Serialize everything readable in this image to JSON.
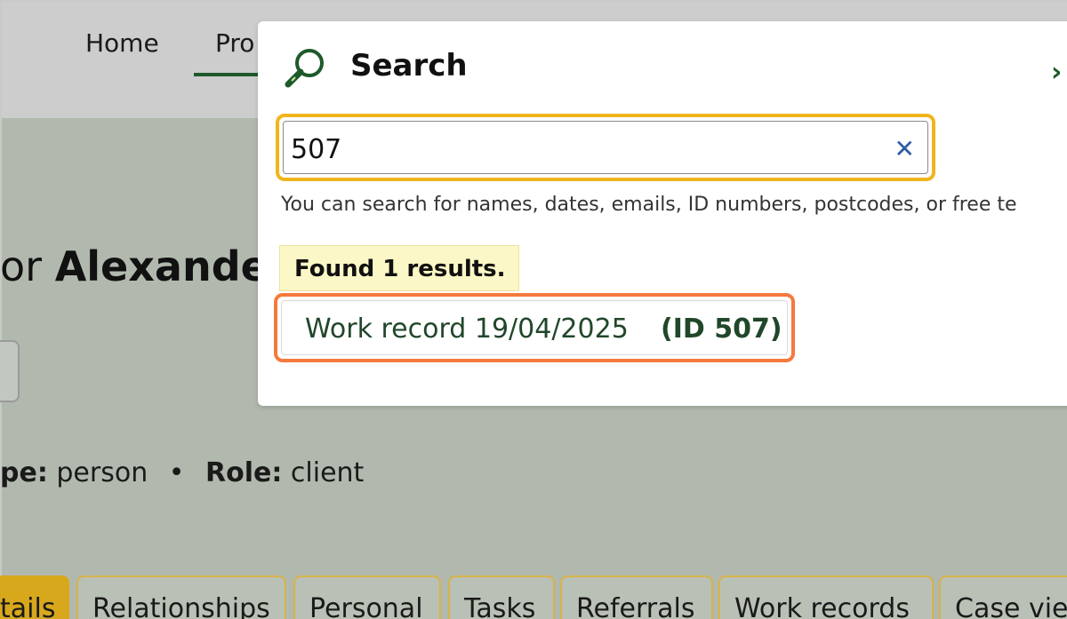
{
  "nav": {
    "home": "Home",
    "profile_partial": "Pro"
  },
  "page": {
    "title_prefix": "or ",
    "title_name": "Alexander",
    "meta_type_label": "pe:",
    "meta_type_value": "person",
    "meta_sep": "•",
    "meta_role_label": "Role:",
    "meta_role_value": "client"
  },
  "tabs": [
    {
      "label": "tails"
    },
    {
      "label": "Relationships"
    },
    {
      "label": "Personal"
    },
    {
      "label": "Tasks"
    },
    {
      "label": "Referrals"
    },
    {
      "label": "Work records"
    },
    {
      "label": "Case vie"
    }
  ],
  "search": {
    "title": "Search",
    "close_glyph": "›",
    "query": "507",
    "clear_glyph": "✕",
    "hint": "You can search for names, dates, emails, ID numbers, postcodes, or free te",
    "found_text": "Found 1 results.",
    "results": [
      {
        "label": "Work record 19/04/2025",
        "id_text": "(ID 507)"
      }
    ]
  },
  "icons": {
    "search": "magnifier-icon"
  },
  "colors": {
    "accent": "#1d5a2a",
    "focus": "#f1b51c",
    "highlight": "#f57a3c",
    "active_tab": "#d8a81c"
  }
}
